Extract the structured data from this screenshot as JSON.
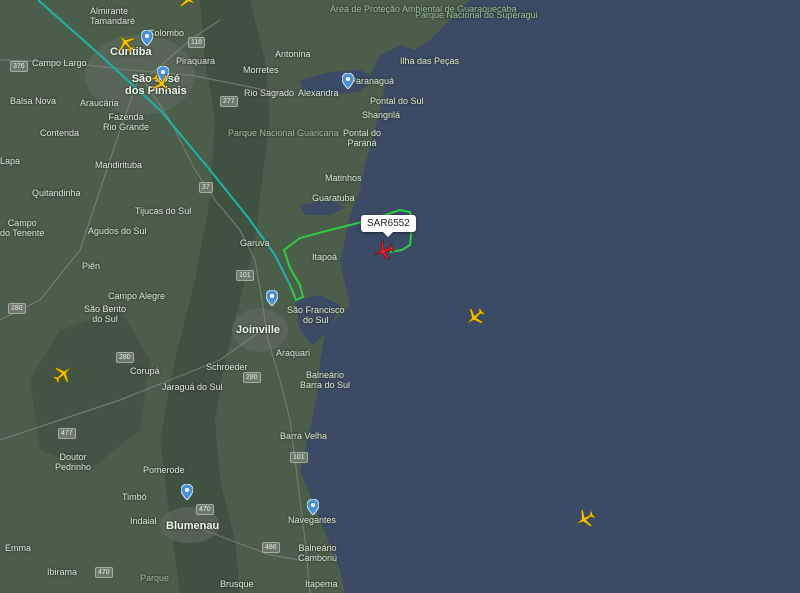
{
  "map": {
    "colors": {
      "land": "#4b5e4a",
      "ocean": "#3b4b66",
      "track_green": "#2ecc40",
      "track_teal": "#20b2aa",
      "plane_yellow": "#f5c400",
      "plane_selected": "#e8202a"
    },
    "selected_flight": {
      "callsign": "SAR6552"
    },
    "cities": [
      {
        "name": "Curitiba",
        "type": "city"
      },
      {
        "name": "São José\ndos Pinhais",
        "type": "city"
      },
      {
        "name": "Joinville",
        "type": "city"
      },
      {
        "name": "Blumenau",
        "type": "city"
      }
    ],
    "places": [
      "Almirante\nTamandaré",
      "Colombo",
      "Campo Largo",
      "Piraquara",
      "Morretes",
      "Antonina",
      "Paranaguá",
      "Ilha das Peças",
      "Balsa Nova",
      "Araucária",
      "Fazenda\nRio Grande",
      "Rio Sagrado",
      "Alexandra",
      "Pontal do Sul",
      "Shangrilá",
      "Pontal do\nParaná",
      "Contenda",
      "Lapa",
      "Mandirituba",
      "Matinhos",
      "Quitandinha",
      "Guaratuba",
      "Tijucas do Sul",
      "Campo\ndo Tenente",
      "Agudos do Sul",
      "Garuva",
      "Itapoá",
      "Piên",
      "Campo Alegre",
      "São Bento\ndo Sul",
      "São Francisco\ndo Sul",
      "Araquari",
      "Corupá",
      "Schroeder",
      "Jaraguá do Sul",
      "Balneário\nBarra do Sul",
      "Barra Velha",
      "Doutor\nPedrinho",
      "Pomerode",
      "Timbó",
      "Indaial",
      "Navegantes",
      "Ibirama",
      "Balneário\nCamboriú",
      "Brusque",
      "Itapema",
      "Emma"
    ],
    "parks": [
      "Área de Proteção Ambiental\nde Guaraqueçaba",
      "Parque\nNacional do\nSuperagui",
      "Parque\nNacional\nGuaricana",
      "Parque"
    ],
    "roads": [
      "376",
      "116",
      "277",
      "37",
      "101",
      "280",
      "280",
      "477",
      "470",
      "101",
      "486",
      "470"
    ],
    "aircraft_icons": [
      "plane-icon",
      "plane-icon",
      "plane-icon",
      "plane-icon",
      "plane-icon",
      "plane-icon-selected"
    ],
    "pin_icons": [
      "location-pin-icon"
    ]
  }
}
